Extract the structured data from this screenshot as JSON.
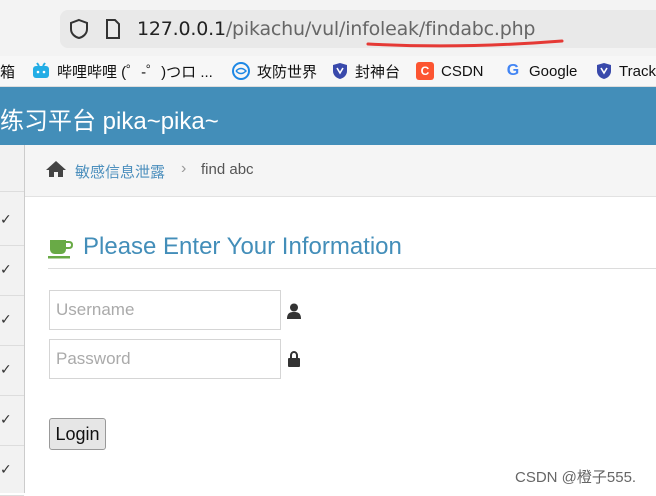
{
  "browser": {
    "url_host": "127.0.0.1",
    "url_path": "/pikachu/vul/infoleak/findabc.php",
    "annotation_color": "#e53935"
  },
  "bookmarks": [
    {
      "label": "箱",
      "icon": "folder-icon"
    },
    {
      "label": "哔哩哔哩 (゜-゜)つロ ...",
      "icon": "bilibili-icon",
      "color": "#23ade5"
    },
    {
      "label": "攻防世界",
      "icon": "globe-icon",
      "color": "#1e88e5"
    },
    {
      "label": "封神台",
      "icon": "shield-badge-icon",
      "color": "#3949ab"
    },
    {
      "label": "CSDN",
      "icon": "csdn-icon",
      "icon_text": "C",
      "color": "#fc5531"
    },
    {
      "label": "Google",
      "icon": "google-icon",
      "icon_text": "G"
    },
    {
      "label": "Track",
      "icon": "shield-badge-icon",
      "color": "#3949ab"
    }
  ],
  "header": {
    "brand": "练习平台 pika~pika~",
    "color": "#438eb9"
  },
  "breadcrumb": {
    "section": "敏感信息泄露",
    "separator": "›",
    "current": "find abc"
  },
  "form": {
    "title": "Please Enter Your Information",
    "username_placeholder": "Username",
    "username_value": "",
    "password_placeholder": "Password",
    "password_value": "",
    "login_label": "Login"
  },
  "sidebar": {
    "check_glyph": "✓"
  },
  "watermark": "CSDN @橙子555."
}
